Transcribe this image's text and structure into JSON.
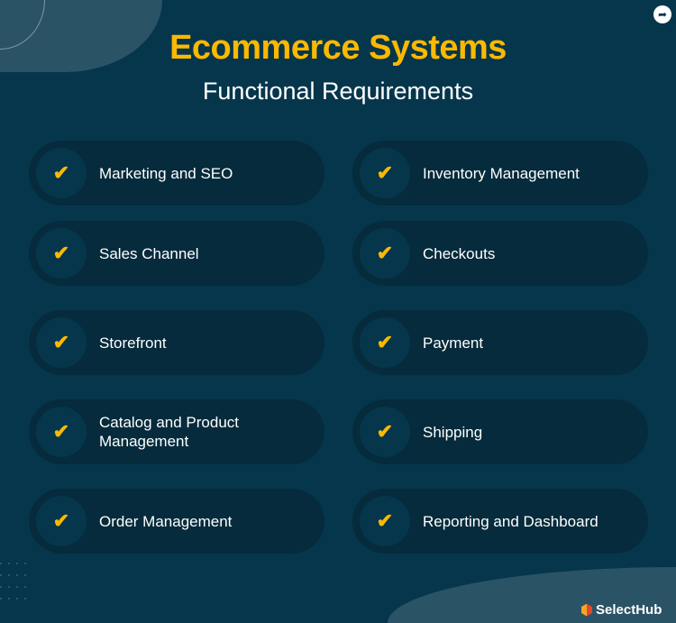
{
  "header": {
    "title": "Ecommerce Systems",
    "subtitle": "Functional Requirements"
  },
  "colors": {
    "background": "#06364c",
    "pill": "#052b3c",
    "accent": "#fbb900"
  },
  "items": [
    {
      "label": "Marketing and SEO",
      "icon": "check-icon"
    },
    {
      "label": "Inventory Management",
      "icon": "check-icon"
    },
    {
      "label": "Sales Channel",
      "icon": "check-icon"
    },
    {
      "label": "Checkouts",
      "icon": "check-icon"
    },
    {
      "label": "Storefront",
      "icon": "check-icon"
    },
    {
      "label": "Payment",
      "icon": "check-icon"
    },
    {
      "label": "Catalog and Product Management",
      "icon": "check-icon"
    },
    {
      "label": "Shipping",
      "icon": "check-icon"
    },
    {
      "label": "Order Management",
      "icon": "check-icon"
    },
    {
      "label": "Reporting and Dashboard",
      "icon": "check-icon"
    }
  ],
  "brand": {
    "logo_text": "SelectHub"
  },
  "share_icon": "share-icon"
}
